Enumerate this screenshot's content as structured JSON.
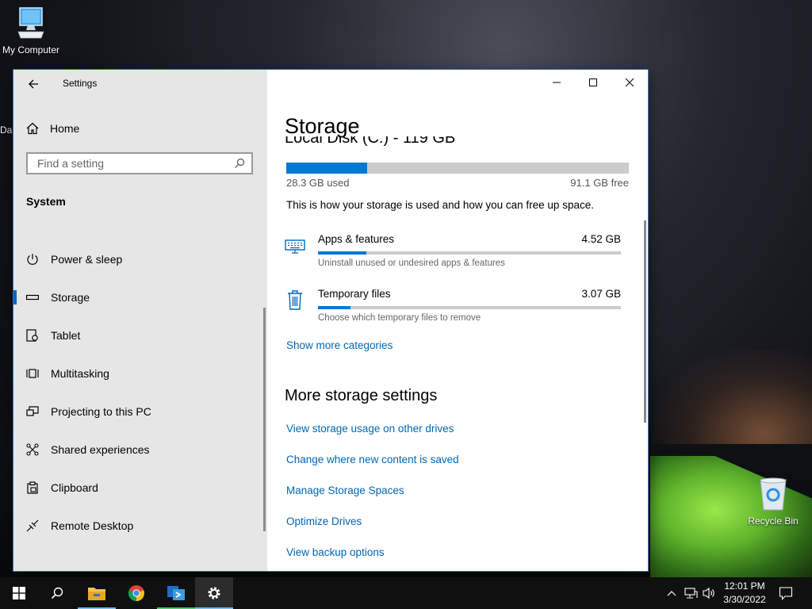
{
  "desktop": {
    "icons": [
      {
        "label": "My Computer"
      },
      {
        "label": "Recycle Bin"
      }
    ],
    "partial_label": "Da"
  },
  "window": {
    "title": "Settings",
    "sidebar": {
      "home_label": "Home",
      "search_placeholder": "Find a setting",
      "section_label": "System",
      "items": [
        {
          "label": "Power & sleep",
          "icon": "power-icon"
        },
        {
          "label": "Storage",
          "icon": "storage-icon",
          "selected": true
        },
        {
          "label": "Tablet",
          "icon": "tablet-icon"
        },
        {
          "label": "Multitasking",
          "icon": "multitasking-icon"
        },
        {
          "label": "Projecting to this PC",
          "icon": "projecting-icon"
        },
        {
          "label": "Shared experiences",
          "icon": "shared-experiences-icon"
        },
        {
          "label": "Clipboard",
          "icon": "clipboard-icon"
        },
        {
          "label": "Remote Desktop",
          "icon": "remote-desktop-icon"
        }
      ]
    },
    "main": {
      "title": "Storage",
      "disk_label": "Local Disk (C:) - 119 GB",
      "used_text": "28.3 GB used",
      "free_text": "91.1 GB free",
      "used_fraction": 0.237,
      "intro": "This is how your storage is used and how you can free up space.",
      "categories": [
        {
          "name": "Apps & features",
          "size": "4.52 GB",
          "description": "Uninstall unused or undesired apps & features",
          "fraction": 0.16,
          "icon": "keyboard-icon"
        },
        {
          "name": "Temporary files",
          "size": "3.07 GB",
          "description": "Choose which temporary files to remove",
          "fraction": 0.108,
          "icon": "trash-icon"
        }
      ],
      "show_more": "Show more categories",
      "more_settings_title": "More storage settings",
      "links": [
        "View storage usage on other drives",
        "Change where new content is saved",
        "Manage Storage Spaces",
        "Optimize Drives",
        "View backup options"
      ]
    }
  },
  "taskbar": {
    "items": [
      "start-icon",
      "search-icon",
      "file-explorer-icon",
      "chrome-icon",
      "remote-desktop-app-icon",
      "settings-icon"
    ],
    "clock": {
      "time": "12:01 PM",
      "date": "3/30/2022"
    }
  },
  "colors": {
    "accent": "#0078d4",
    "link": "#0066b4",
    "sidebar_bg": "#e6e6e6"
  }
}
